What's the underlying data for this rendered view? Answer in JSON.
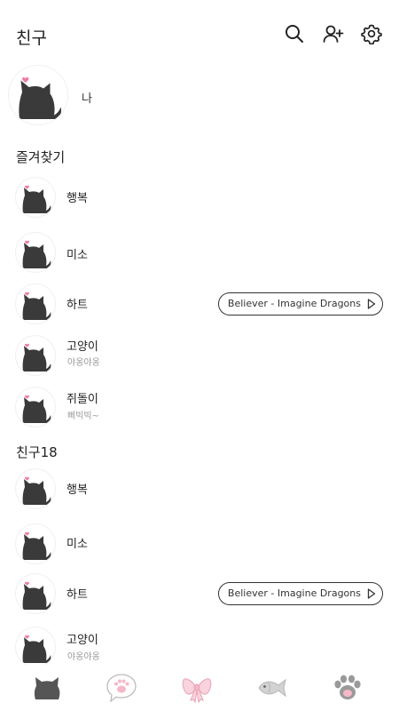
{
  "header": {
    "title": "친구",
    "icons": [
      "search-icon",
      "add-friend-icon",
      "settings-icon"
    ]
  },
  "me": {
    "name": "나"
  },
  "sections": {
    "favorites": "즐겨찾기",
    "friends": "친구18"
  },
  "favorites": [
    {
      "name": "행복",
      "status": "",
      "music": ""
    },
    {
      "name": "미소",
      "status": "",
      "music": ""
    },
    {
      "name": "하트",
      "status": "",
      "music": "Believer - Imagine Dragons"
    },
    {
      "name": "고양이",
      "status": "야옹야옹",
      "music": ""
    },
    {
      "name": "쥐돌이",
      "status": "삐빅빅~",
      "music": ""
    }
  ],
  "friends": [
    {
      "name": "행복",
      "status": "",
      "music": ""
    },
    {
      "name": "미소",
      "status": "",
      "music": ""
    },
    {
      "name": "하트",
      "status": "",
      "music": "Believer - Imagine Dragons"
    },
    {
      "name": "고양이",
      "status": "야옹야옹",
      "music": ""
    }
  ],
  "tabs": [
    "cat-head-icon",
    "chat-paw-icon",
    "ribbon-icon",
    "fish-icon",
    "paw-icon"
  ],
  "colors": {
    "cat": "#3a3a3a",
    "heart": "#f07aa0",
    "tab_pink": "#f5b8c8",
    "tab_gray": "#b5b5b5"
  }
}
